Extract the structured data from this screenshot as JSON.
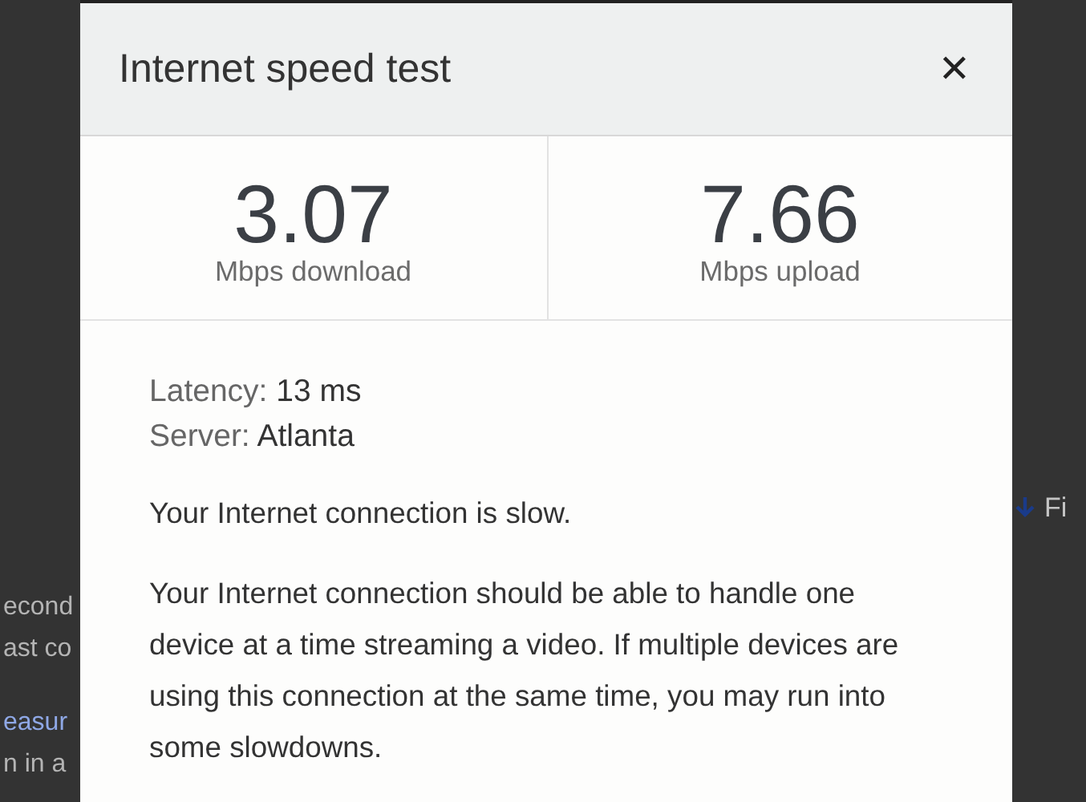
{
  "background": {
    "left_fragments": [
      {
        "text": "econd",
        "kind": "text"
      },
      {
        "text": "ast co",
        "kind": "text"
      },
      {
        "text": "easur",
        "kind": "link"
      },
      {
        "text": "n in a",
        "kind": "text"
      }
    ],
    "right_button": {
      "label": "Fi"
    }
  },
  "dialog": {
    "title": "Internet speed test",
    "close": "✕",
    "stats": [
      {
        "value": "3.07",
        "unit": "Mbps download"
      },
      {
        "value": "7.66",
        "unit": "Mbps upload"
      }
    ],
    "details": [
      {
        "label": "Latency:",
        "value": "13 ms"
      },
      {
        "label": "Server:",
        "value": "Atlanta"
      }
    ],
    "verdict": "Your Internet connection is slow.",
    "explanation": "Your Internet connection should be able to handle one device at a time streaming a video. If multiple devices are using this connection at the same time, you may run into some slowdowns."
  }
}
